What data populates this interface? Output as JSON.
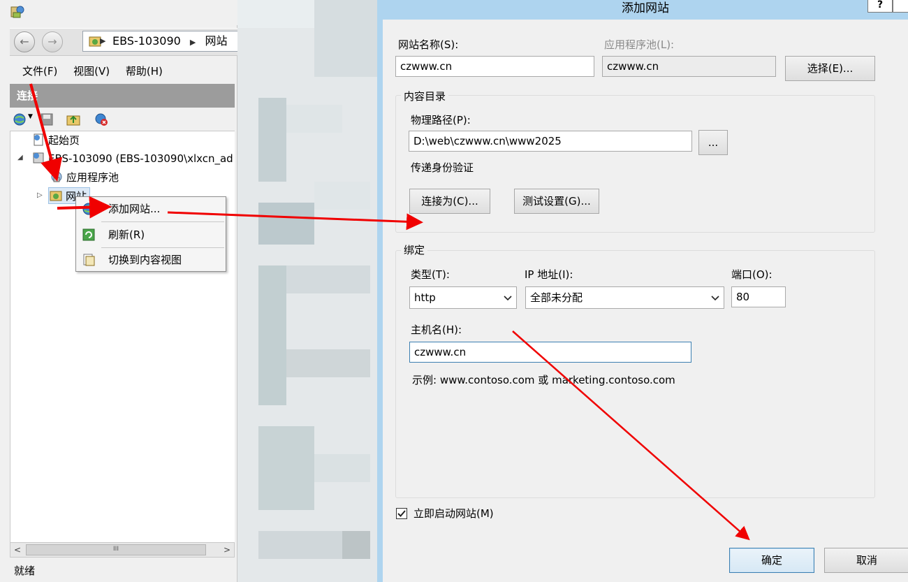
{
  "iis": {
    "address": {
      "server": "EBS-103090",
      "node": "网站"
    },
    "menu": [
      "文件(F)",
      "视图(V)",
      "帮助(H)"
    ],
    "connections_header": "连接",
    "tree": [
      {
        "label": "起始页"
      },
      {
        "label": "EBS-103090 (EBS-103090\\xlxcn_ad"
      },
      {
        "label": "应用程序池"
      },
      {
        "label": "网站"
      }
    ],
    "context_menu": [
      "添加网站...",
      "刷新(R)",
      "切换到内容视图"
    ],
    "status": "就绪",
    "scroll_left": "<",
    "scroll_right": ">",
    "scroll_grip": "III"
  },
  "dialog": {
    "title": "添加网站",
    "help": "?",
    "site_name_label": "网站名称(S):",
    "site_name": "czwww.cn",
    "app_pool_label": "应用程序池(L):",
    "app_pool": "czwww.cn",
    "select_button": "选择(E)...",
    "content_dir_title": "内容目录",
    "physical_path_label": "物理路径(P):",
    "physical_path": "D:\\web\\czwww.cn\\www2025",
    "browse_button": "...",
    "pass_auth_label": "传递身份验证",
    "connect_as_button": "连接为(C)...",
    "test_settings_button": "测试设置(G)...",
    "binding_title": "绑定",
    "type_label": "类型(T):",
    "type_value": "http",
    "ip_label": "IP 地址(I):",
    "ip_value": "全部未分配",
    "port_label": "端口(O):",
    "port_value": "80",
    "hostname_label": "主机名(H):",
    "hostname_value": "czwww.cn",
    "example_text": "示例: www.contoso.com 或 marketing.contoso.com",
    "start_now_label": "立即启动网站(M)",
    "start_now_checked": true,
    "ok_button": "确定",
    "cancel_button": "取消"
  },
  "colors": {
    "dialog_border": "#aed4ef",
    "annotation_arrow": "#f00000",
    "connections_header_bg": "#9c9c9c"
  }
}
